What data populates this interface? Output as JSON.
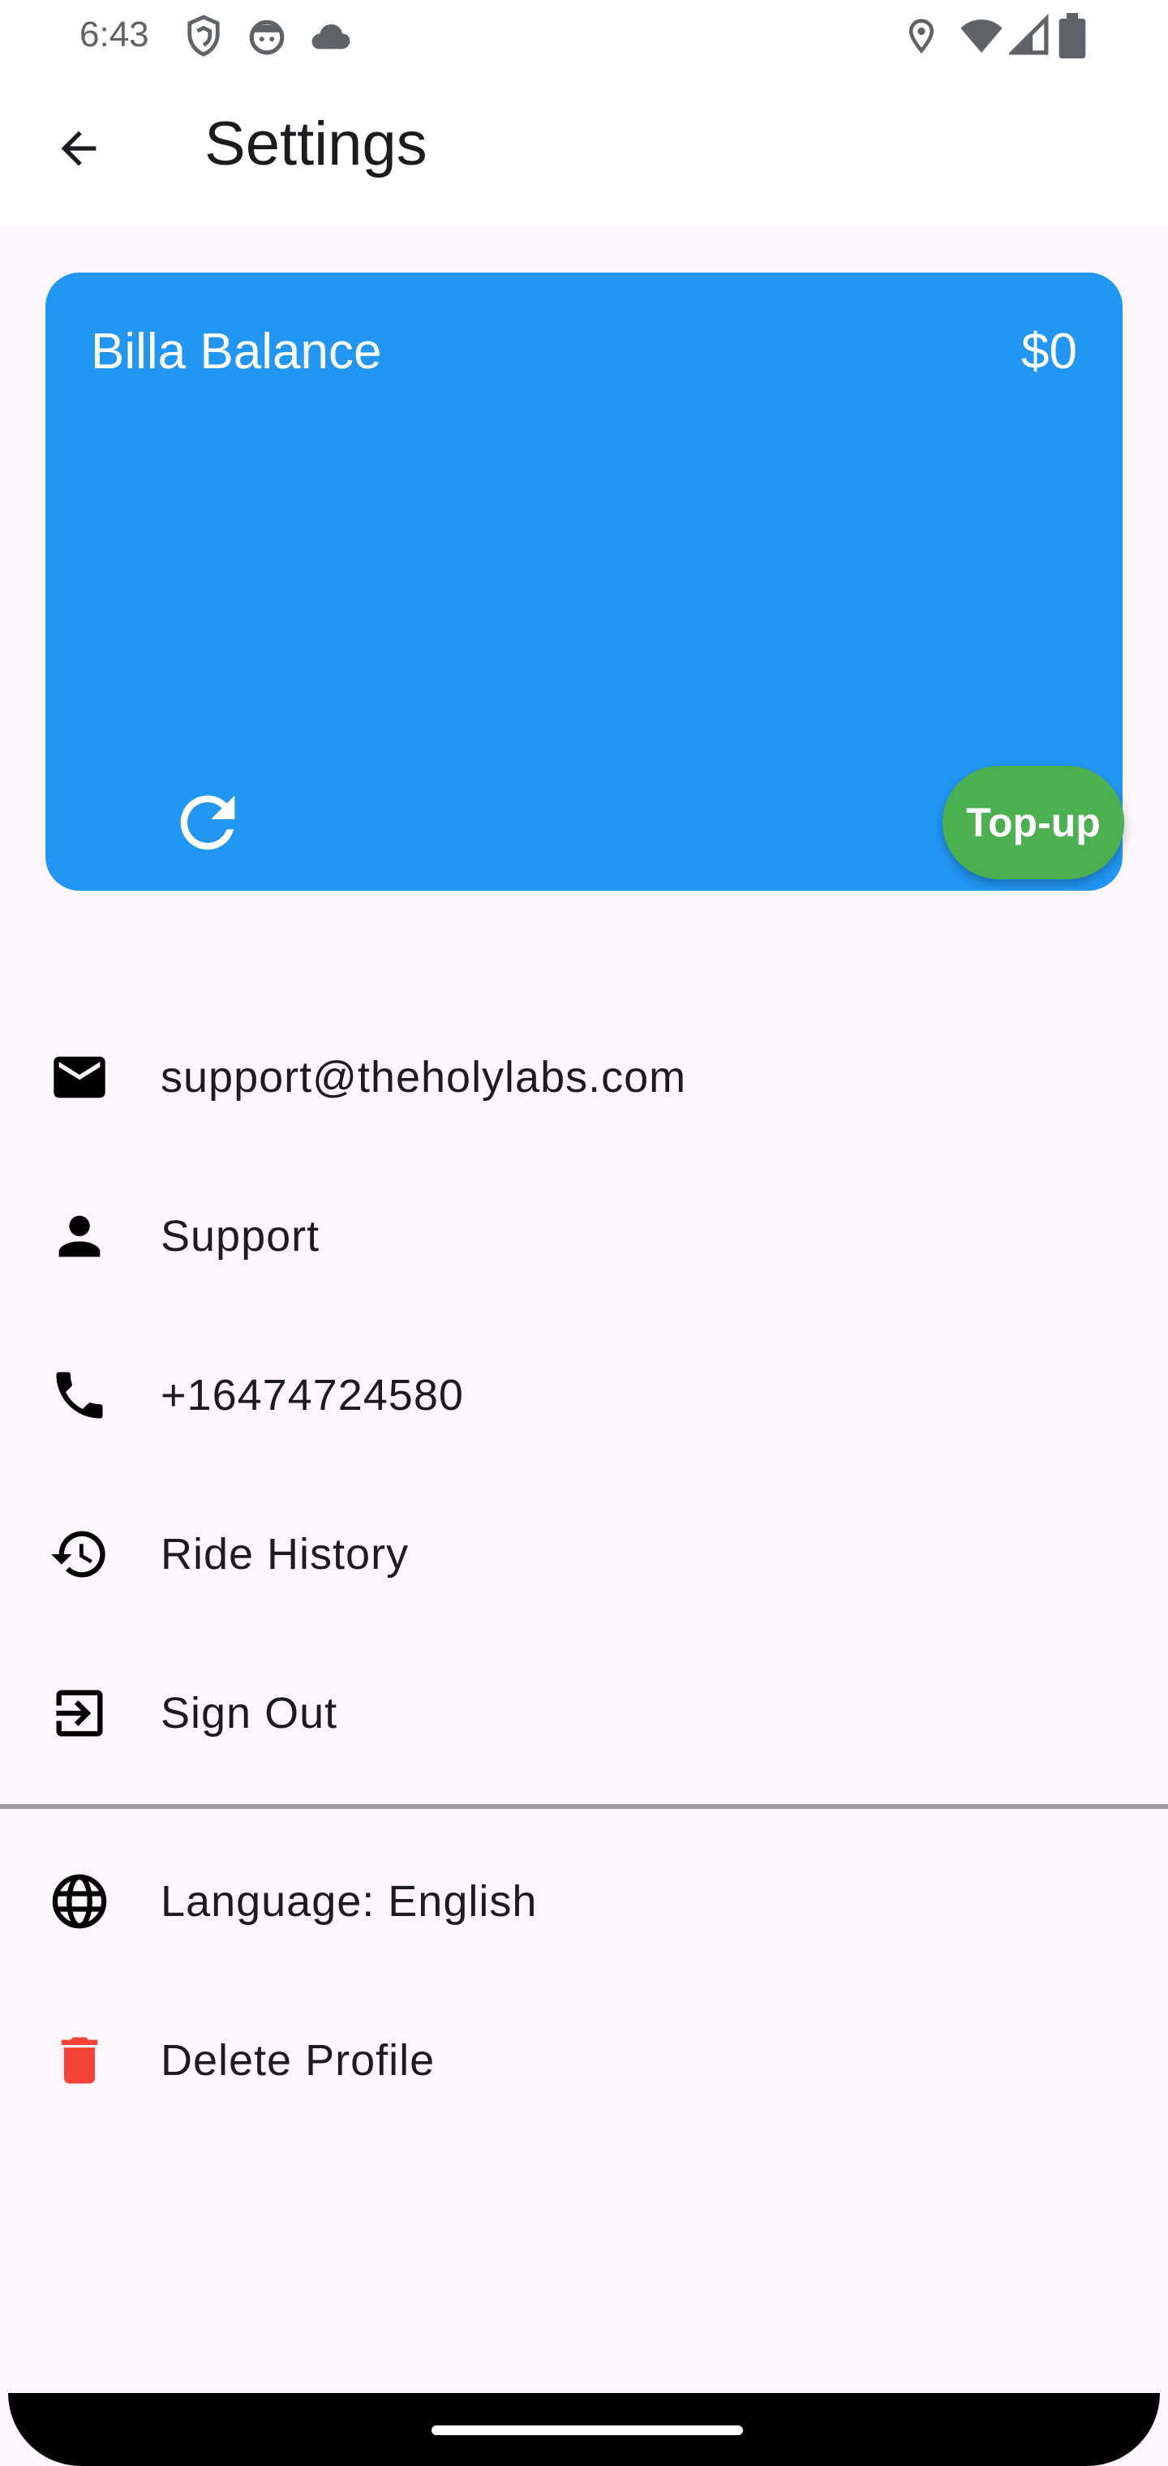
{
  "status_bar": {
    "time": "6:43",
    "left_icons": [
      "shield-icon",
      "face-icon",
      "cloud-icon"
    ],
    "right_icons": [
      "location-icon",
      "wifi-icon",
      "signal-icon",
      "battery-icon"
    ]
  },
  "app_bar": {
    "title": "Settings",
    "back_icon": "arrow-back-icon"
  },
  "balance_card": {
    "label": "Billa Balance",
    "amount": "$0",
    "refresh_icon": "refresh-icon",
    "topup_label": "Top-up",
    "card_color": "#2196f3",
    "topup_color": "#4caf50"
  },
  "menu": {
    "items": [
      {
        "icon": "email-icon",
        "label": "support@theholylabs.com"
      },
      {
        "icon": "person-icon",
        "label": "Support"
      },
      {
        "icon": "phone-icon",
        "label": "+16474724580"
      },
      {
        "icon": "history-icon",
        "label": "Ride History"
      },
      {
        "icon": "sign-out-icon",
        "label": "Sign Out"
      }
    ],
    "secondary_items": [
      {
        "icon": "globe-icon",
        "label": "Language: English"
      },
      {
        "icon": "trash-icon",
        "label": "Delete Profile",
        "icon_color": "#f44336"
      }
    ]
  }
}
